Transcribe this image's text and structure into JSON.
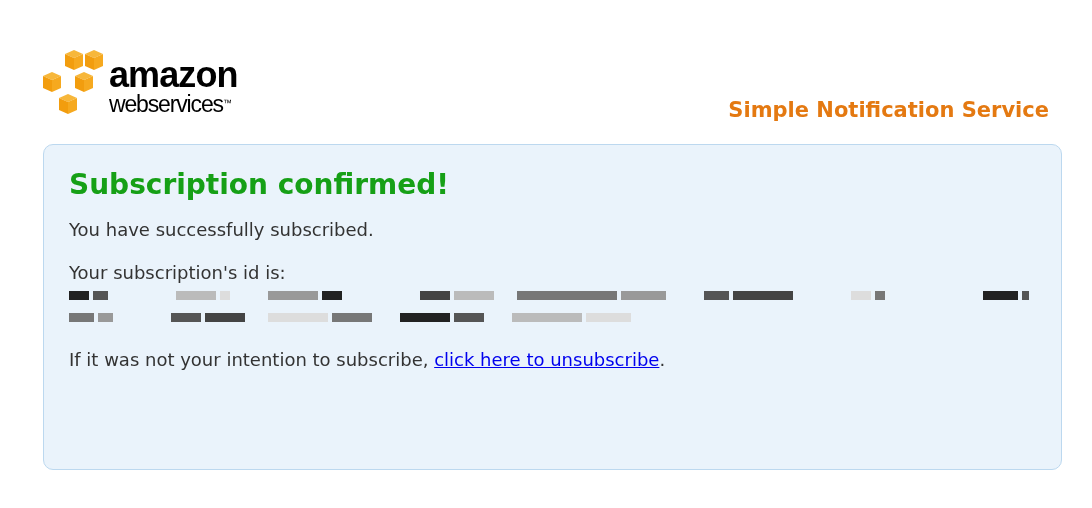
{
  "header": {
    "logo_word": "amazon",
    "logo_subword": "webservices",
    "logo_mark": "™",
    "service_name": "Simple Notification Service"
  },
  "panel": {
    "title": "Subscription confirmed!",
    "message": "You have successfully subscribed.",
    "id_label": "Your subscription's id is:",
    "unsubscribe_text": "If it was not your intention to subscribe, ",
    "unsubscribe_link": "click here to unsubscribe",
    "unsubscribe_end": "."
  }
}
